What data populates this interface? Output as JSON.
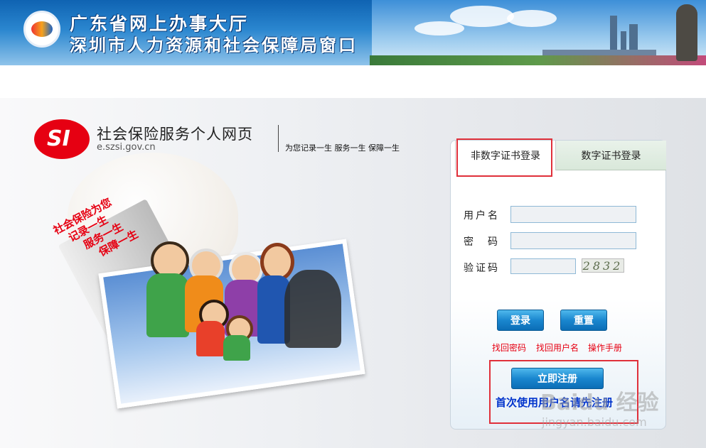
{
  "header": {
    "title_line1": "广东省网上办事大厅",
    "title_line2": "深圳市人力资源和社会保障局窗口"
  },
  "brand": {
    "logo_text": "SI",
    "title": "社会保险服务个人网页",
    "url": "e.szsi.gov.cn",
    "slogan": "为您记录一生  服务一生  保障一生"
  },
  "illustration": {
    "slogan_lines": [
      "社会保险为您",
      "记录一生",
      "服务一生",
      "保障一生"
    ]
  },
  "login": {
    "tabs": [
      {
        "label": "非数字证书登录",
        "active": true
      },
      {
        "label": "数字证书登录",
        "active": false
      }
    ],
    "fields": {
      "username_label": "用户名",
      "password_label": "密　码",
      "captcha_label": "验证码",
      "username_value": "",
      "password_value": "",
      "captcha_value": ""
    },
    "captcha_image_text": "2832",
    "buttons": {
      "login": "登录",
      "reset": "重置",
      "register": "立即注册"
    },
    "links": {
      "recover_password": "找回密码",
      "recover_username": "找回用户名",
      "manual": "操作手册"
    },
    "register_note": "首次使用用户名请先注册"
  },
  "watermark": {
    "text": "Baidu 经验",
    "url": "jingyan.baidu.com"
  },
  "colors": {
    "highlight_box": "#e0303a",
    "link_red": "#e60012",
    "note_blue": "#0033cc",
    "button_blue": "#1a87cf"
  }
}
